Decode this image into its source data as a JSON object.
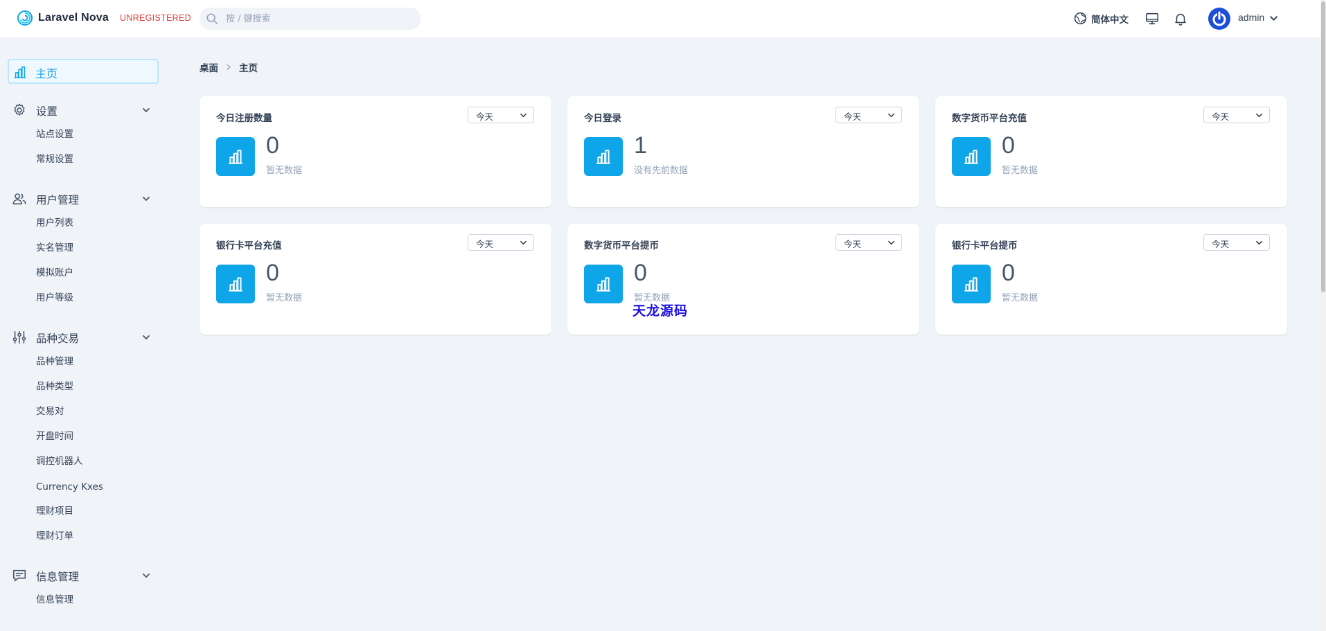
{
  "header": {
    "brand_name": "Laravel Nova",
    "brand_tag": "UNREGISTERED",
    "search_placeholder": "按 / 键搜索",
    "language": "简体中文",
    "user_name": "admin"
  },
  "sidebar": {
    "home": "主页",
    "groups": [
      {
        "label": "设置",
        "icon": "gear-icon",
        "items": [
          "站点设置",
          "常规设置"
        ]
      },
      {
        "label": "用户管理",
        "icon": "users-icon",
        "items": [
          "用户列表",
          "实名管理",
          "模拟账户",
          "用户等级"
        ]
      },
      {
        "label": "品种交易",
        "icon": "sliders-icon",
        "items": [
          "品种管理",
          "品种类型",
          "交易对",
          "开盘时间",
          "调控机器人",
          "Currency Kxes",
          "理财项目",
          "理财订单"
        ]
      },
      {
        "label": "信息管理",
        "icon": "chat-icon",
        "items": [
          "信息管理"
        ]
      }
    ]
  },
  "breadcrumb": {
    "root": "桌面",
    "current": "主页"
  },
  "cards": [
    {
      "title": "今日注册数量",
      "range": "今天",
      "value": "0",
      "note": "暂无数据"
    },
    {
      "title": "今日登录",
      "range": "今天",
      "value": "1",
      "note": "没有先前数据"
    },
    {
      "title": "数字货币平台充值",
      "range": "今天",
      "value": "0",
      "note": "暂无数据"
    },
    {
      "title": "银行卡平台充值",
      "range": "今天",
      "value": "0",
      "note": "暂无数据"
    },
    {
      "title": "数字货币平台提币",
      "range": "今天",
      "value": "0",
      "note": "暂无数据"
    },
    {
      "title": "银行卡平台提币",
      "range": "今天",
      "value": "0",
      "note": "暂无数据"
    }
  ],
  "watermark": "天龙源码",
  "colors": {
    "accent": "#0ea5e9",
    "brand_tag": "#e53e3e",
    "background": "#f0f4f9",
    "watermark": "#1d10e6"
  }
}
